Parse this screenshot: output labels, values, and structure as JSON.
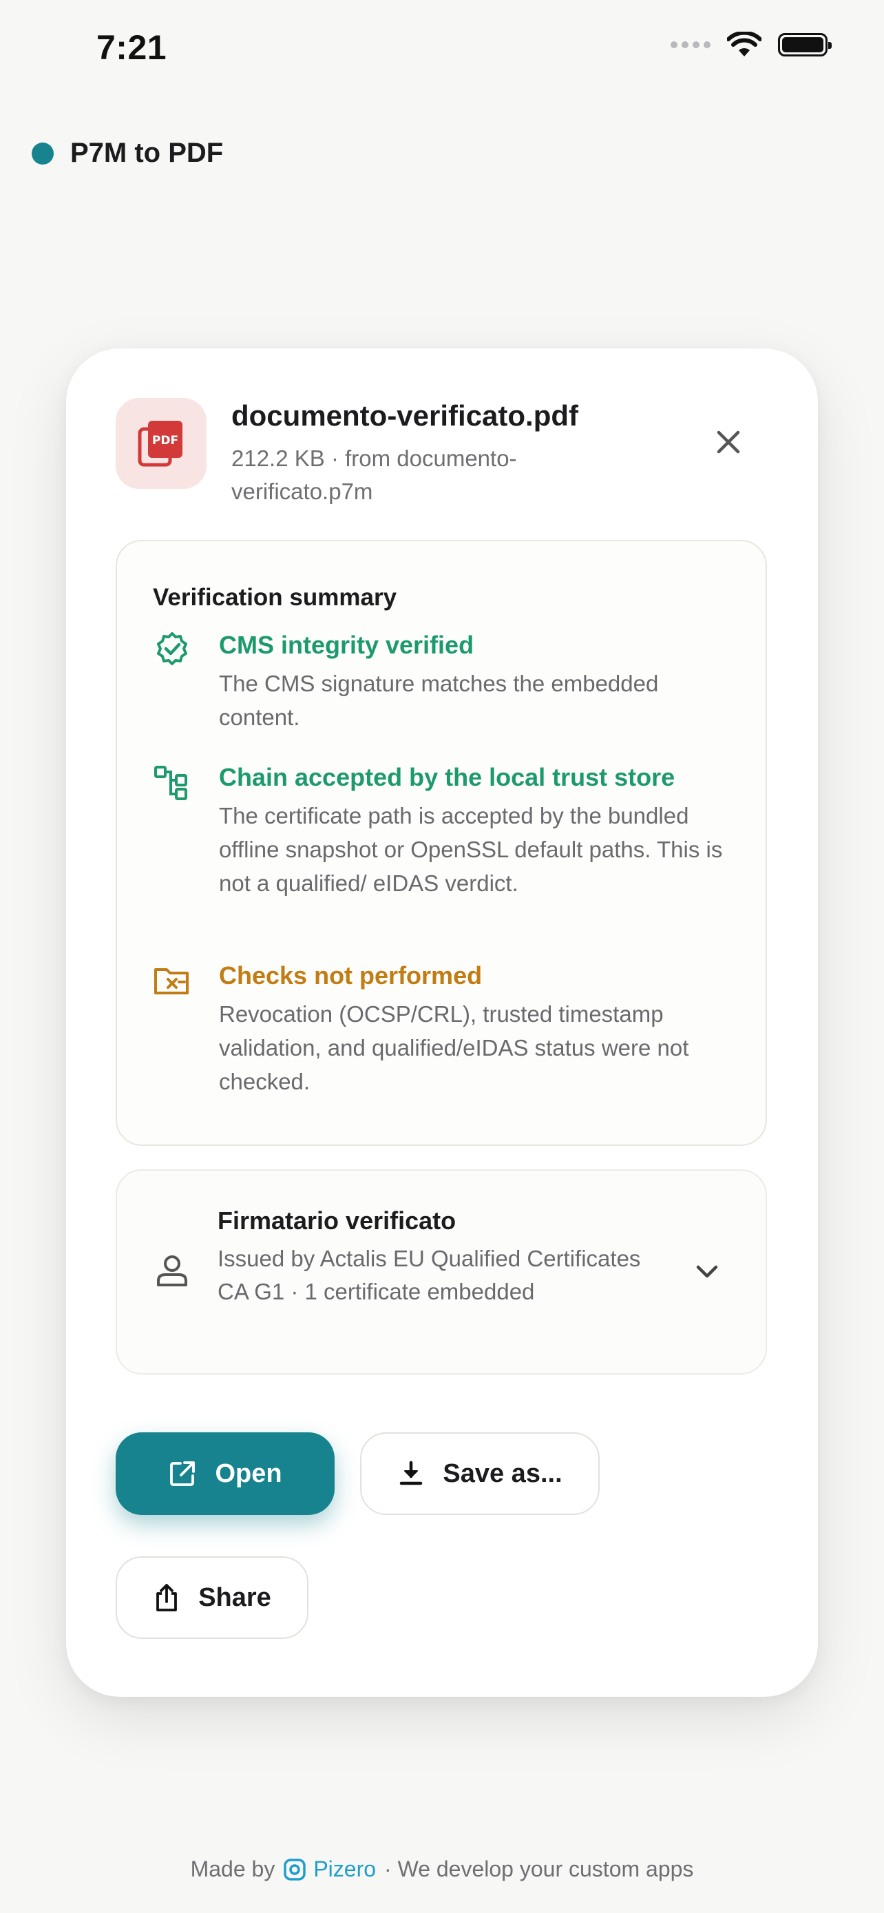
{
  "status_bar": {
    "time": "7:21"
  },
  "app": {
    "title": "P7M to PDF",
    "accent": "#17838f"
  },
  "file": {
    "icon_label": "PDF",
    "name": "documento-verificato.pdf",
    "meta": "212.2 KB · from documento-verificato.p7m"
  },
  "verification": {
    "title": "Verification summary",
    "checks": [
      {
        "icon": "badge-check-icon",
        "title": "CMS integrity verified",
        "description": "The CMS signature matches the embedded content.",
        "status": "ok"
      },
      {
        "icon": "chain-tree-icon",
        "title": "Chain accepted by the local trust store",
        "description": "The certificate path is accepted by the bundled offline snapshot or OpenSSL default paths. This is not a qualified/ eIDAS verdict.",
        "status": "ok"
      },
      {
        "icon": "folder-x-icon",
        "title": "Checks not performed",
        "description": "Revocation (OCSP/CRL), trusted timestamp validation, and qualified/eIDAS status were not checked.",
        "status": "warning"
      }
    ]
  },
  "signer": {
    "title": "Firmatario verificato",
    "description": "Issued by Actalis EU Qualified Certificates CA G1 · 1 certificate embedded"
  },
  "actions": {
    "open_label": "Open",
    "save_label": "Save as...",
    "share_label": "Share"
  },
  "footer": {
    "prefix": "Made by",
    "brand": "Pizero",
    "suffix": "· We develop your custom apps"
  },
  "colors": {
    "ok": "#1d9a6c",
    "warning": "#c27c14",
    "pdf_red": "#d23a3a",
    "brand_blue": "#1f9ecb"
  }
}
